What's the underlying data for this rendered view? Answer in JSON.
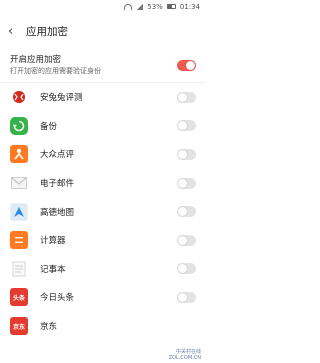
{
  "status_bar": {
    "battery": "53%",
    "time": "01:34"
  },
  "header": {
    "title": "应用加密"
  },
  "master": {
    "title": "开启应用加密",
    "subtitle": "打开加密的应用需要验证身份",
    "enabled": true
  },
  "apps": [
    {
      "name": "安兔兔评测",
      "icon": "antutu-icon",
      "enabled": false
    },
    {
      "name": "备份",
      "icon": "backup-icon",
      "enabled": false
    },
    {
      "name": "大众点评",
      "icon": "dianping-icon",
      "enabled": false
    },
    {
      "name": "电子邮件",
      "icon": "mail-icon",
      "enabled": false
    },
    {
      "name": "高德地图",
      "icon": "amap-icon",
      "enabled": false
    },
    {
      "name": "计算器",
      "icon": "calculator-icon",
      "enabled": false
    },
    {
      "name": "记事本",
      "icon": "notepad-icon",
      "enabled": false
    },
    {
      "name": "今日头条",
      "icon": "toutiao-icon",
      "icon_text": "头条",
      "enabled": false
    },
    {
      "name": "京东",
      "icon": "jd-icon",
      "icon_text": "京东",
      "enabled": false
    }
  ],
  "colors": {
    "accent": "#ef5a4f",
    "toggle_off": "#e3e3e3"
  },
  "watermark": {
    "line1": "中关村在线",
    "line2": "ZOL.COM.CN"
  }
}
